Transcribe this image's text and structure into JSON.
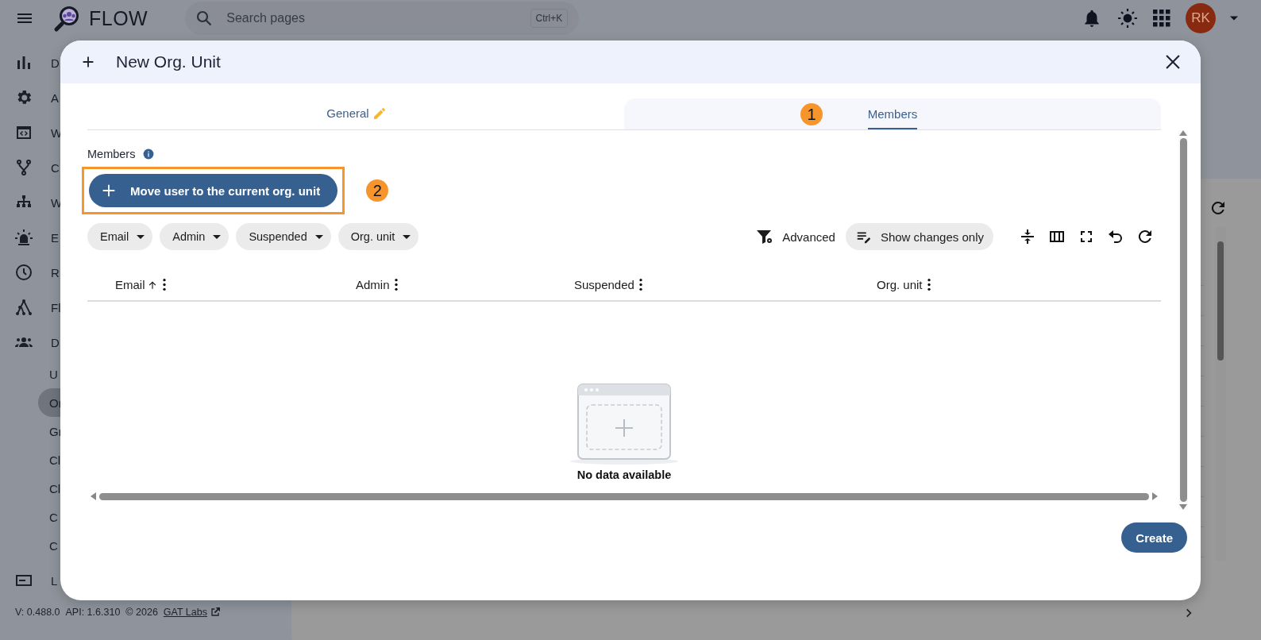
{
  "app": {
    "title": "FLOW"
  },
  "search": {
    "placeholder": "Search pages",
    "shortcut": "Ctrl+K"
  },
  "user": {
    "initials": "RK"
  },
  "sidebar": {
    "items": [
      {
        "label": "D",
        "selected": false
      },
      {
        "label": "A",
        "selected": false
      },
      {
        "label": "W",
        "selected": false
      },
      {
        "label": "C",
        "selected": false
      },
      {
        "label": "W",
        "selected": false
      },
      {
        "label": "E",
        "selected": false
      },
      {
        "label": "R",
        "selected": false
      },
      {
        "label": "Fl",
        "selected": false
      },
      {
        "label": "D",
        "selected": false,
        "children": [
          {
            "label": "U",
            "selected": false
          },
          {
            "label": "Or",
            "selected": true
          },
          {
            "label": "Gr",
            "selected": false
          },
          {
            "label": "Cl",
            "selected": false
          },
          {
            "label": "Cl",
            "selected": false
          },
          {
            "label": "C",
            "selected": false
          },
          {
            "label": "C",
            "selected": false
          }
        ]
      },
      {
        "label": "L",
        "selected": false
      }
    ]
  },
  "footer": {
    "version": "V: 0.488.0",
    "api": "API: 1.6.310",
    "copyright": "© 2026",
    "link": "GAT Labs"
  },
  "dialog": {
    "title": "New Org. Unit",
    "tabs": [
      {
        "label": "General",
        "selected": false,
        "edited": true
      },
      {
        "label": "Members",
        "selected": true,
        "edited": false
      }
    ],
    "section_label": "Members",
    "add_button": "Move user to the current org. unit",
    "filters": [
      "Email",
      "Admin",
      "Suspended",
      "Org. unit"
    ],
    "toolbar": {
      "advanced": "Advanced",
      "changes": "Show changes only"
    },
    "table": {
      "columns": [
        {
          "label": "Email",
          "sorted": true
        },
        {
          "label": "Admin",
          "sorted": false
        },
        {
          "label": "Suspended",
          "sorted": false
        },
        {
          "label": "Org. unit",
          "sorted": false
        }
      ],
      "empty_text": "No data available"
    },
    "create_button": "Create"
  },
  "annotations": [
    "1",
    "2"
  ]
}
